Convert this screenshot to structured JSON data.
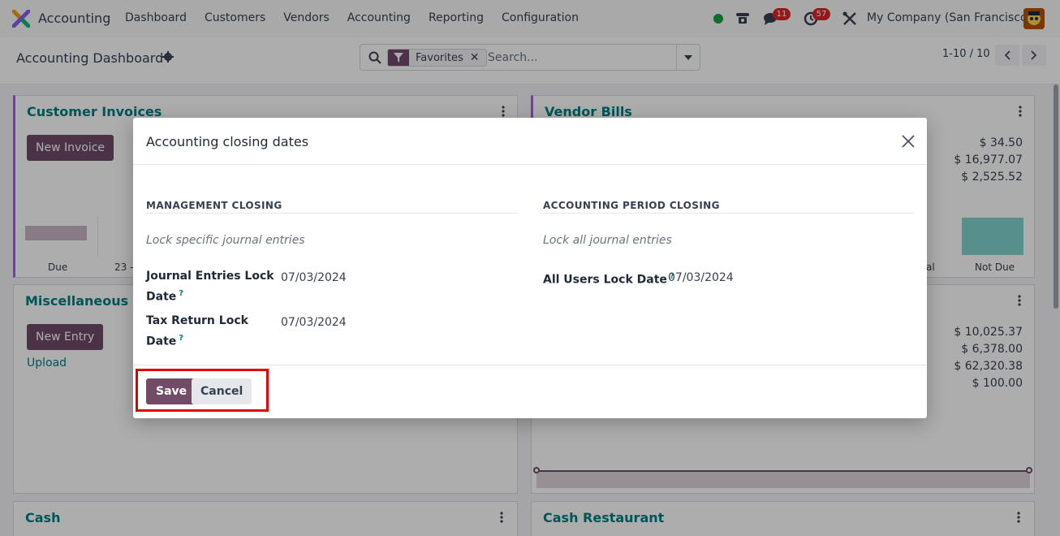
{
  "navbar": {
    "app_name": "Accounting",
    "menu": [
      "Dashboard",
      "Customers",
      "Vendors",
      "Accounting",
      "Reporting",
      "Configuration"
    ],
    "chat_badge": "11",
    "activity_badge": "57",
    "company": "My Company (San Francisco)"
  },
  "control": {
    "title": "Accounting Dashboard",
    "facet_label": "Favorites",
    "search_placeholder": "Search...",
    "pager": "1-10 / 10"
  },
  "cards": {
    "customer_invoices": {
      "title": "Customer Invoices",
      "button": "New Invoice",
      "axis": [
        "Due",
        "23 -"
      ]
    },
    "vendor_bills": {
      "title": "Vendor Bills",
      "amounts": [
        "$ 34.50",
        "$ 16,977.07",
        "$ 2,525.52"
      ],
      "axis": [
        "al",
        "Not Due"
      ]
    },
    "misc": {
      "title": "Miscellaneous Op",
      "button": "New Entry",
      "link": "Upload"
    },
    "bank": {
      "amounts": [
        "$ 10,025.37",
        "$ 6,378.00",
        "$ 62,320.38",
        "$ 100.00"
      ]
    },
    "cash": {
      "title": "Cash"
    },
    "cash_restaurant": {
      "title": "Cash Restaurant"
    }
  },
  "modal": {
    "title": "Accounting closing dates",
    "management": {
      "heading": "MANAGEMENT CLOSING",
      "help": "Lock specific journal entries",
      "fields": [
        {
          "label_line1": "Journal Entries Lock",
          "label_line2": "Date",
          "value": "07/03/2024"
        },
        {
          "label_line1": "Tax Return Lock",
          "label_line2": "Date",
          "value": "07/03/2024"
        }
      ]
    },
    "period": {
      "heading": "ACCOUNTING PERIOD CLOSING",
      "help": "Lock all journal entries",
      "fields": [
        {
          "label": "All Users Lock Date",
          "value": "07/03/2024"
        }
      ]
    },
    "tooltip_mark": "?",
    "save_label": "Save",
    "cancel_label": "Cancel"
  },
  "colors": {
    "brand": "#714b67",
    "teal": "#017e84",
    "accent_border": "#9b6ad1",
    "highlight": "#e00000"
  }
}
